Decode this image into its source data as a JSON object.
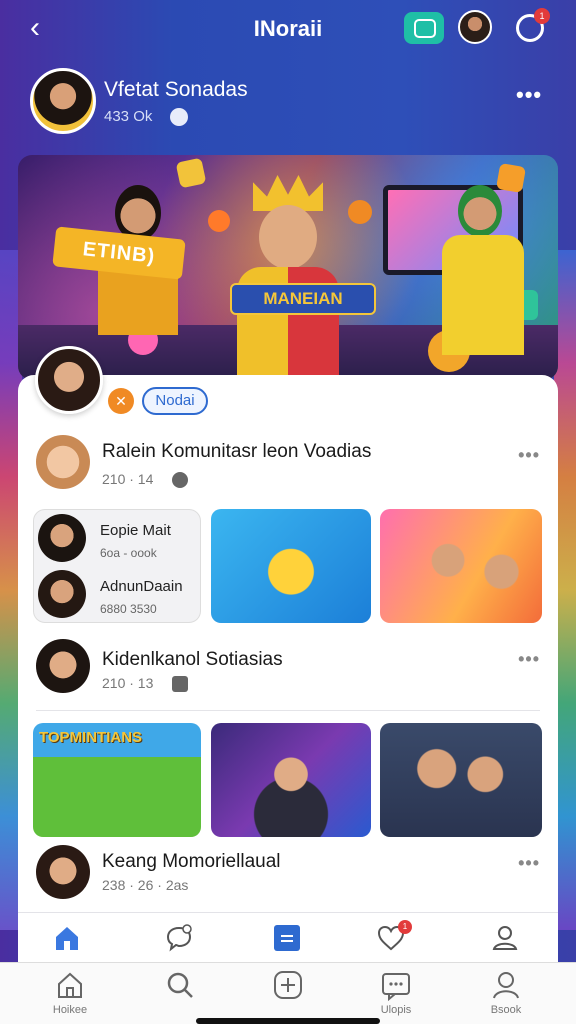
{
  "header": {
    "back_icon": "back-chevron-icon",
    "title": "INoraii",
    "notification_count": "1"
  },
  "profile": {
    "name": "Vfetat Sonadas",
    "meta": "433 Ok",
    "more": "•••"
  },
  "banner": {
    "sign_left": "ETINB)",
    "sign_center": "MANEIAN"
  },
  "card": {
    "tag_icon": "✕",
    "tag_label": "Nodai",
    "posts": [
      {
        "title": "Ralein Komunitasr leon Voadias",
        "meta": "210 · 14",
        "more": "•••"
      },
      {
        "title": "Kidenlkanol Sotiasias",
        "meta": "210 · 13",
        "more": "•••"
      },
      {
        "title": "Keang Momoriellaual",
        "meta": "238 · 26 · 2as",
        "more": "•••"
      }
    ],
    "mini_list": [
      {
        "title": "Eopie Mait",
        "sub": "6oa - oook"
      },
      {
        "title": "AdnunDaain",
        "sub": "6880 3530"
      }
    ],
    "thumb_text": "TOPMINTIANS"
  },
  "tabbar_top": {
    "items": [
      "home-icon",
      "chat-icon",
      "calendar-icon",
      "heart-icon",
      "profile-icon"
    ],
    "heart_badge": "1"
  },
  "tabbar_bottom": {
    "items": [
      {
        "label": "Hoikee",
        "icon": "home-icon"
      },
      {
        "label": "",
        "icon": "search-icon"
      },
      {
        "label": "",
        "icon": "add-icon"
      },
      {
        "label": "Ulopis",
        "icon": "message-icon"
      },
      {
        "label": "Bsook",
        "icon": "user-icon"
      }
    ]
  }
}
